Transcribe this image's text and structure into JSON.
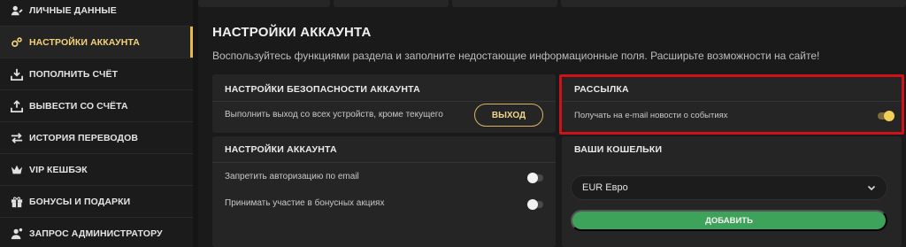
{
  "sidebar": {
    "items": [
      {
        "label": "ЛИЧНЫЕ ДАННЫЕ",
        "icon": "user-edit-icon"
      },
      {
        "label": "НАСТРОЙКИ АККАУНТА",
        "icon": "gears-icon",
        "active": true
      },
      {
        "label": "ПОПОЛНИТЬ СЧЁТ",
        "icon": "deposit-icon"
      },
      {
        "label": "ВЫВЕСТИ СО СЧЁТА",
        "icon": "withdraw-icon"
      },
      {
        "label": "ИСТОРИЯ ПЕРЕВОДОВ",
        "icon": "transfer-arrows-icon"
      },
      {
        "label": "VIP КЕШБЭК",
        "icon": "crown-icon"
      },
      {
        "label": "БОНУСЫ И ПОДАРКИ",
        "icon": "gift-icon"
      },
      {
        "label": "ЗАПРОС АДМИНИСТРАТОРУ",
        "icon": "admin-request-icon"
      }
    ]
  },
  "main": {
    "title": "НАСТРОЙКИ АККАУНТА",
    "subtitle": "Воспользуйтесь функциями раздела и заполните недостающие информационные поля. Расширьте возможности на сайте!"
  },
  "security": {
    "title": "НАСТРОЙКИ БЕЗОПАСНОСТИ АККАУНТА",
    "logout_text": "Выполнить выход со всех устройств, кроме текущего",
    "logout_button": "ВЫХОД"
  },
  "newsletter": {
    "title": "РАССЫЛКА",
    "email_news_text": "Получать на e-mail новости о событиях",
    "email_news_enabled": true
  },
  "account": {
    "title": "НАСТРОЙКИ АККАУНТА",
    "options": [
      {
        "label": "Запретить авторизацию по email",
        "enabled": false
      },
      {
        "label": "Принимать участие в бонусных акциях",
        "enabled": false
      }
    ]
  },
  "wallets": {
    "title": "ВАШИ КОШЕЛЬКИ",
    "selected": "EUR Евро",
    "add_button": "ДОБАВИТЬ"
  },
  "colors": {
    "accent_gold": "#e8b84a",
    "highlight_red": "#d0111a",
    "button_green": "#3ea35a"
  }
}
